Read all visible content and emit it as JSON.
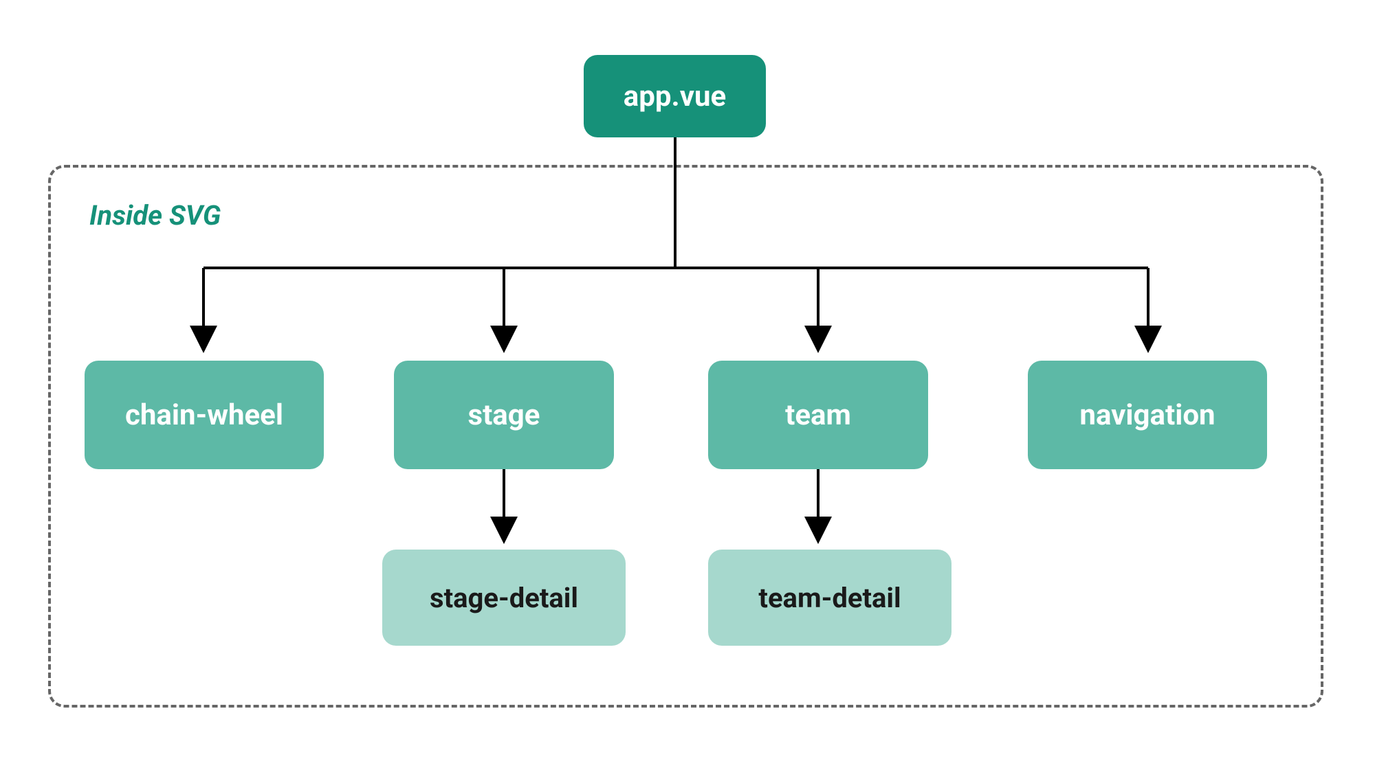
{
  "diagram": {
    "container_label": "Inside SVG",
    "nodes": {
      "root": {
        "label": "app.vue"
      },
      "chain_wheel": {
        "label": "chain-wheel"
      },
      "stage": {
        "label": "stage"
      },
      "team": {
        "label": "team"
      },
      "navigation": {
        "label": "navigation"
      },
      "stage_detail": {
        "label": "stage-detail"
      },
      "team_detail": {
        "label": "team-detail"
      }
    },
    "colors": {
      "root": "#169179",
      "mid": "#5db9a6",
      "leaf": "#a6d8cd",
      "border_dashed": "#666666",
      "label": "#169179"
    }
  }
}
